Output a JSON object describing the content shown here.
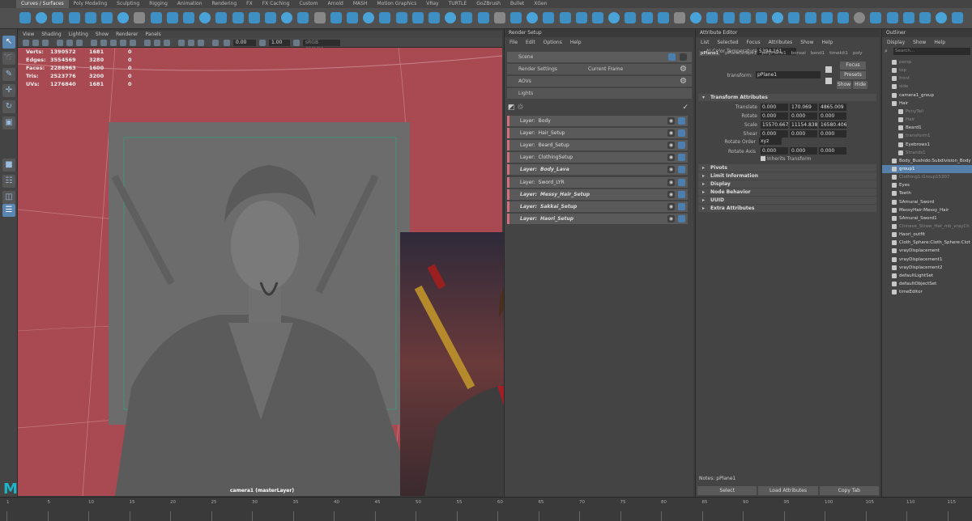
{
  "shelf": {
    "tabs": [
      "Curves / Surfaces",
      "Poly Modeling",
      "Sculpting",
      "Rigging",
      "Animation",
      "Rendering",
      "FX",
      "FX Caching",
      "Custom",
      "Arnold",
      "MASH",
      "Motion Graphics",
      "VRay",
      "TURTLE",
      "GoZBrush",
      "Bullet",
      "XGen"
    ],
    "active_tab": 0
  },
  "viewport": {
    "menu": [
      "View",
      "Shading",
      "Lighting",
      "Show",
      "Renderer",
      "Panels"
    ],
    "field_a": "0.00",
    "field_b": "1.00",
    "field_c": "sRGB gamma",
    "hud": [
      {
        "label": "Verts:",
        "a": "1390572",
        "b": "1681",
        "c": "0"
      },
      {
        "label": "Edges:",
        "a": "3554569",
        "b": "3280",
        "c": "0"
      },
      {
        "label": "Faces:",
        "a": "2286963",
        "b": "1600",
        "c": "0"
      },
      {
        "label": "Tris:",
        "a": "2523776",
        "b": "3200",
        "c": "0"
      },
      {
        "label": "UVs:",
        "a": "1276840",
        "b": "1681",
        "c": "0"
      }
    ],
    "resolution": "1920 x 1080",
    "camera_label": "camera1 (masterLayer)",
    "logo": "M"
  },
  "render_setup": {
    "title": "Render Setup",
    "menu": [
      "File",
      "Edit",
      "Options",
      "Help"
    ],
    "rows": [
      "Scene",
      "Render Settings",
      "AOVs",
      "Lights"
    ],
    "current_frame": "Current Frame",
    "layers": [
      {
        "label": "Layer:",
        "name": "Body",
        "bold": false
      },
      {
        "label": "Layer:",
        "name": "Hair_Setup",
        "bold": false
      },
      {
        "label": "Layer:",
        "name": "Beard_Setup",
        "bold": false
      },
      {
        "label": "Layer:",
        "name": "ClothingSetup",
        "bold": false
      },
      {
        "label": "Layer:",
        "name": "Body_Lava",
        "bold": true
      },
      {
        "label": "Layer:",
        "name": "Sword_LYR",
        "bold": false
      },
      {
        "label": "Layer:",
        "name": "Messy_Hair_Setup",
        "bold": true
      },
      {
        "label": "Layer:",
        "name": "Sakkai_Setup",
        "bold": true
      },
      {
        "label": "Layer:",
        "name": "Haori_Setup",
        "bold": true
      }
    ]
  },
  "attribute_editor": {
    "title": "Attribute Editor",
    "menu": [
      "List",
      "Selected",
      "Focus",
      "Attributes",
      "Show",
      "Help"
    ],
    "color_temp_label": "AI Color Temperature",
    "color_temp_value": "5394.161",
    "tabs": [
      "pPlane1",
      "pPlaneShape1",
      "polyPlane1",
      "bonsai",
      "bend1",
      "timekit1",
      "poly"
    ],
    "transform_label": "transform:",
    "transform_value": "pPlane1",
    "buttons": {
      "focus": "Focus",
      "presets": "Presets",
      "show": "Show",
      "hide": "Hide"
    },
    "transform_section": "Transform Attributes",
    "attrs": [
      {
        "label": "Translate",
        "x": "0.000",
        "y": "170.069",
        "z": "4865.009"
      },
      {
        "label": "Rotate",
        "x": "0.000",
        "y": "0.000",
        "z": "0.000"
      },
      {
        "label": "Scale",
        "x": "15570.667",
        "y": "11154.838",
        "z": "16580.406"
      },
      {
        "label": "Shear",
        "x": "0.000",
        "y": "0.000",
        "z": "0.000"
      }
    ],
    "rotate_order_label": "Rotate Order",
    "rotate_order_value": "xyz",
    "rotate_axis": {
      "label": "Rotate Axis",
      "x": "0.000",
      "y": "0.000",
      "z": "0.000"
    },
    "inherits_transform": "Inherits Transform",
    "sections": [
      "Pivots",
      "Limit Information",
      "Display",
      "Node Behavior",
      "UUID",
      "Extra Attributes"
    ],
    "notes": "Notes:  pPlane1",
    "bottom_buttons": [
      "Select",
      "Load Attributes",
      "Copy Tab"
    ]
  },
  "outliner": {
    "title": "Outliner",
    "menu": [
      "Display",
      "Show",
      "Help"
    ],
    "search_placeholder": "Search...",
    "items": [
      {
        "name": "persp",
        "indent": 1,
        "dim": true,
        "sel": false
      },
      {
        "name": "top",
        "indent": 1,
        "dim": true,
        "sel": false
      },
      {
        "name": "front",
        "indent": 1,
        "dim": true,
        "sel": false
      },
      {
        "name": "side",
        "indent": 1,
        "dim": true,
        "sel": false
      },
      {
        "name": "camera1_group",
        "indent": 1,
        "dim": false,
        "sel": false
      },
      {
        "name": "Hair",
        "indent": 1,
        "dim": false,
        "sel": false
      },
      {
        "name": "PonyTail",
        "indent": 2,
        "dim": true,
        "sel": false
      },
      {
        "name": "Hair",
        "indent": 2,
        "dim": true,
        "sel": false
      },
      {
        "name": "Beard1",
        "indent": 2,
        "dim": false,
        "sel": false
      },
      {
        "name": "transform1",
        "indent": 2,
        "dim": true,
        "sel": false
      },
      {
        "name": "Eyebrows1",
        "indent": 2,
        "dim": false,
        "sel": false
      },
      {
        "name": "Strands1",
        "indent": 2,
        "dim": true,
        "sel": false
      },
      {
        "name": "Body_Bushido:Subdivision_Body",
        "indent": 1,
        "dim": false,
        "sel": false
      },
      {
        "name": "group1",
        "indent": 1,
        "dim": false,
        "sel": true
      },
      {
        "name": "Clothing1:Group15307",
        "indent": 1,
        "dim": true,
        "sel": false
      },
      {
        "name": "Eyes",
        "indent": 1,
        "dim": false,
        "sel": false
      },
      {
        "name": "Teeth",
        "indent": 1,
        "dim": false,
        "sel": false
      },
      {
        "name": "SAmurai_Sword",
        "indent": 1,
        "dim": false,
        "sel": false
      },
      {
        "name": "MessyHair:Messy_Hair",
        "indent": 1,
        "dim": false,
        "sel": false
      },
      {
        "name": "SAmurai_Sword1",
        "indent": 1,
        "dim": false,
        "sel": false
      },
      {
        "name": "Chinese_Straw_Hat_mb_vrayCh",
        "indent": 1,
        "dim": true,
        "sel": false
      },
      {
        "name": "Haori_outfit",
        "indent": 1,
        "dim": false,
        "sel": false
      },
      {
        "name": "Cloth_Sphere:Cloth_Sphere:Clot",
        "indent": 1,
        "dim": false,
        "sel": false
      },
      {
        "name": "vrayDisplacement",
        "indent": 1,
        "dim": false,
        "sel": false
      },
      {
        "name": "vrayDisplacement1",
        "indent": 1,
        "dim": false,
        "sel": false
      },
      {
        "name": "vrayDisplacement2",
        "indent": 1,
        "dim": false,
        "sel": false
      },
      {
        "name": "defaultLightSet",
        "indent": 1,
        "dim": false,
        "sel": false
      },
      {
        "name": "defaultObjectSet",
        "indent": 1,
        "dim": false,
        "sel": false
      },
      {
        "name": "timeEditor",
        "indent": 1,
        "dim": false,
        "sel": false
      }
    ]
  },
  "timeline": {
    "numbers": [
      "1",
      "5",
      "10",
      "15",
      "20",
      "25",
      "30",
      "35",
      "40",
      "45",
      "50",
      "55",
      "60",
      "65",
      "70",
      "75",
      "80",
      "85",
      "90",
      "95",
      "100",
      "105",
      "110",
      "115"
    ]
  },
  "colors": {
    "viewport_red": "#a94a52",
    "selection_blue": "#5680aa",
    "layer_accent": "#d46f7c",
    "maya_logo": "#1fb3c7"
  }
}
